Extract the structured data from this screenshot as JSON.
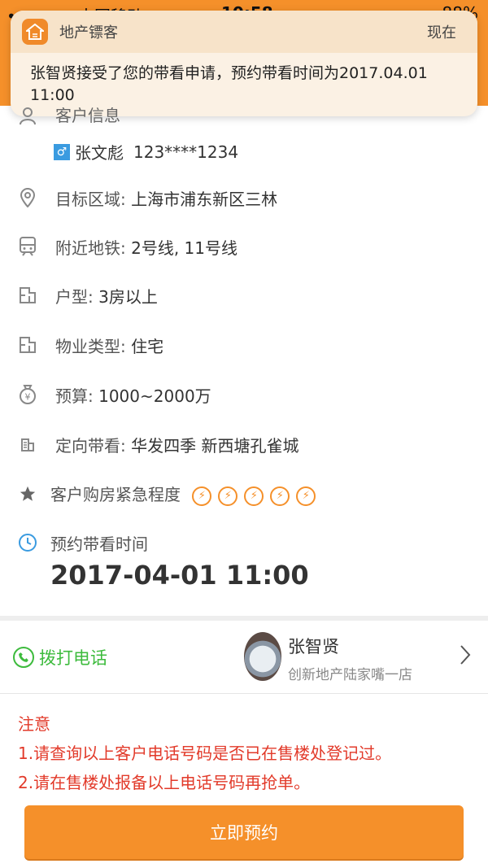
{
  "status_bar": {
    "carrier": "•○○○○ 中国移动",
    "time": "10:58",
    "battery": "88%"
  },
  "notification": {
    "app_name": "地产镖客",
    "time": "现在",
    "message": "张智贤接受了您的带看申请，预约带看时间为2017.04.01 11:00"
  },
  "client": {
    "section_label": "客户信息",
    "gender_symbol": "♂",
    "name": "张文彪",
    "phone": "123****1234"
  },
  "details": [
    {
      "icon": "location-pin-icon",
      "label": "目标区域: ",
      "value": "上海市浦东新区三林"
    },
    {
      "icon": "subway-icon",
      "label": "附近地铁: ",
      "value": "2号线, 11号线"
    },
    {
      "icon": "floorplan-icon",
      "label": "户型: ",
      "value": "3房以上"
    },
    {
      "icon": "floorplan-icon",
      "label": "物业类型: ",
      "value": "住宅"
    },
    {
      "icon": "money-bag-icon",
      "label": "预算: ",
      "value": "1000~2000万"
    },
    {
      "icon": "building-icon",
      "label": "定向带看: ",
      "value": "华发四季  新西塘孔雀城"
    }
  ],
  "urgency": {
    "label": "客户购房紧急程度",
    "level": 5,
    "max": 5
  },
  "appointment": {
    "label": "预约带看时间",
    "datetime": "2017-04-01 11:00"
  },
  "agent": {
    "call_label": "拨打电话",
    "name": "张智贤",
    "store": "创新地产陆家嘴一店"
  },
  "notice": {
    "title": "注意",
    "line1": "1.请查询以上客户电话号码是否已在售楼处登记过。",
    "line2": "2.请在售楼处报备以上电话号码再抢单。"
  },
  "actions": {
    "book_label": "立即预约"
  },
  "colors": {
    "accent": "#f5902a",
    "call_green": "#3dbb3d",
    "warning_red": "#e23a2a"
  }
}
